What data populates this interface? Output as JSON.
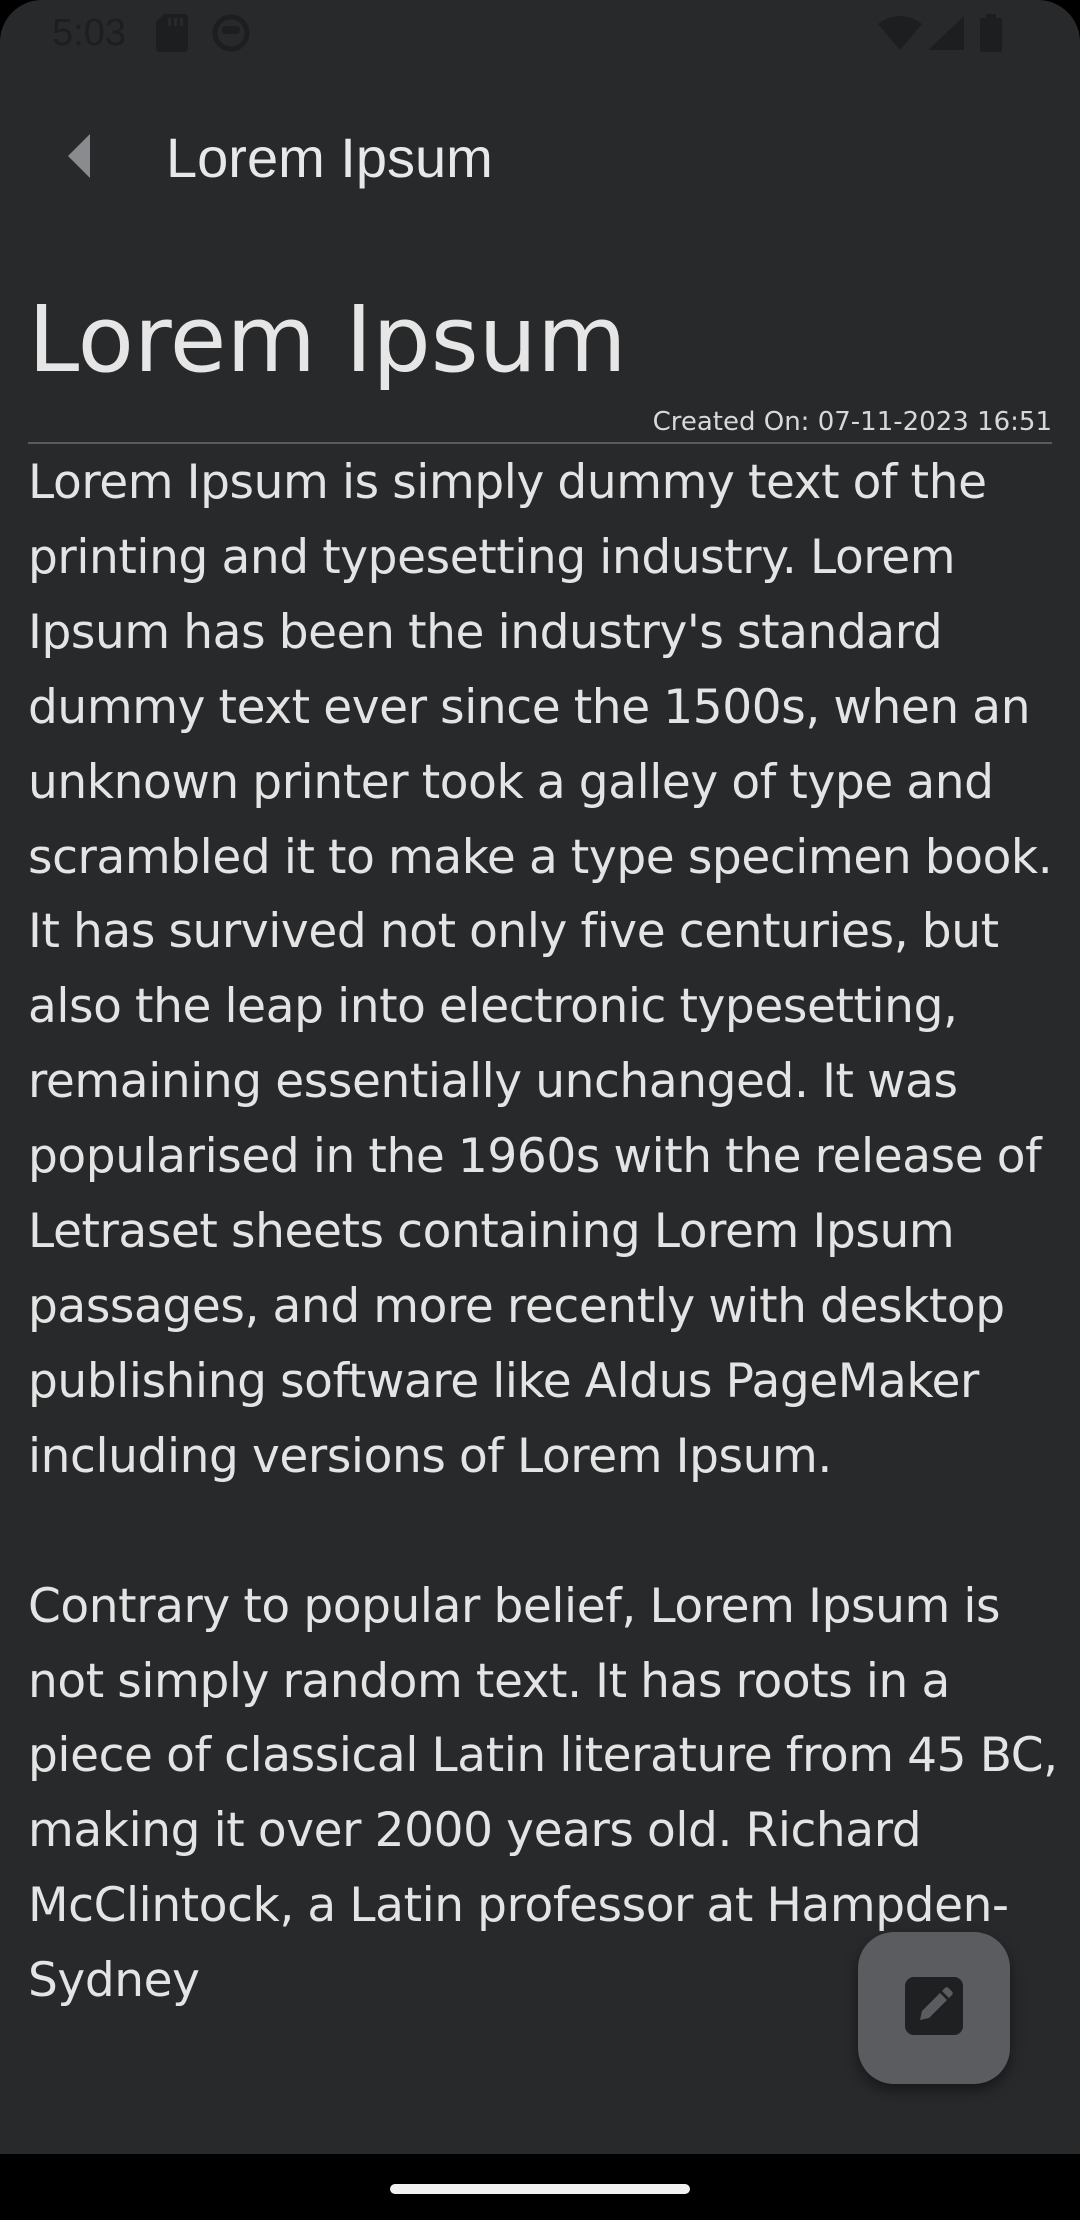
{
  "status_bar": {
    "time": "5:03",
    "icons": [
      "sd-card-icon",
      "face-icon",
      "wifi-icon",
      "signal-icon",
      "battery-icon"
    ]
  },
  "app_bar": {
    "back_icon": "back-triangle-icon",
    "title": "Lorem Ipsum"
  },
  "note": {
    "title": "Lorem Ipsum",
    "created_on": "Created On: 07-11-2023 16:51",
    "body": "Lorem Ipsum is simply dummy text of the printing and typesetting industry. Lorem Ipsum has been the industry's standard dummy text ever since the 1500s, when an unknown printer took a galley of type and scrambled it to make a type specimen book. It has survived not only five centuries, but also the leap into electronic typesetting, remaining essentially unchanged. It was popularised in the 1960s with the release of Letraset sheets containing Lorem Ipsum passages, and more recently with desktop publishing software like Aldus PageMaker including versions of Lorem Ipsum.\n\nContrary to popular belief, Lorem Ipsum is not simply random text. It has roots in a piece of classical Latin literature from 45 BC, making it over 2000 years old. Richard McClintock, a Latin professor at Hampden-Sydney"
  },
  "fab": {
    "icon": "edit-pencil-icon"
  },
  "colors": {
    "background": "#28292b",
    "text": "#e6e6e6",
    "fab": "#5a5c5f",
    "divider": "#5a5b5e"
  }
}
